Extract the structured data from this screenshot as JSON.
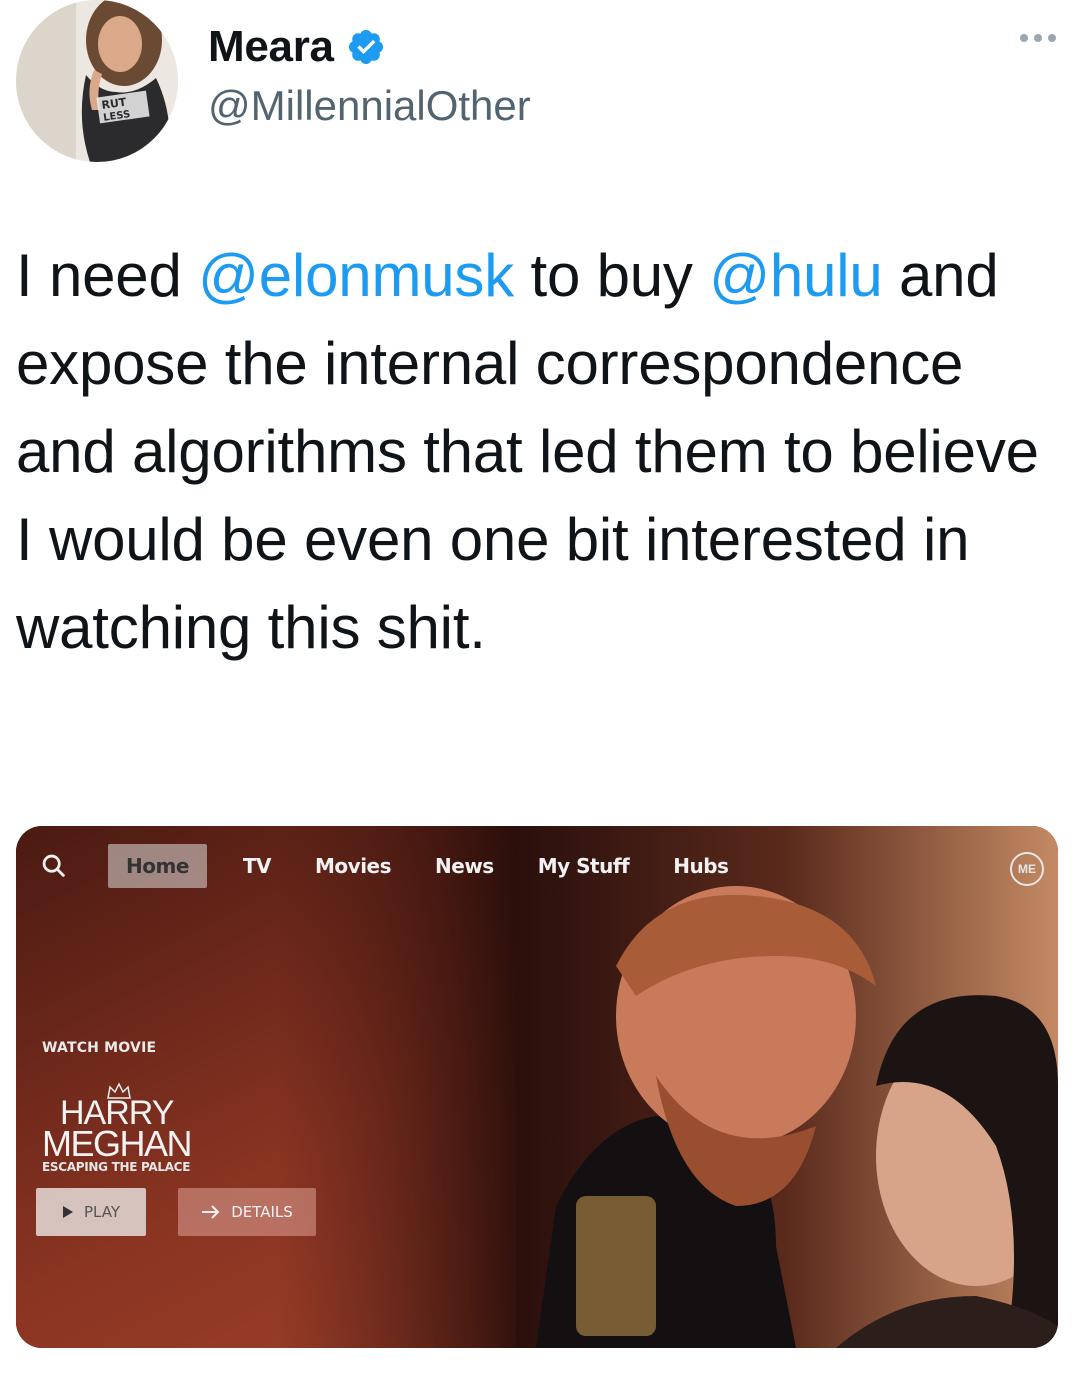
{
  "author": {
    "display_name": "Meara",
    "handle": "@MillennialOther",
    "verified_icon": "verified-badge-icon",
    "more_icon": "more-dots-icon"
  },
  "tweet": {
    "text_parts": {
      "p1": "I need ",
      "mention1": "@elonmusk",
      "p2": " to buy ",
      "mention2": "@hulu",
      "p3": " and expose the internal correspondence and algorithms that led them to believe I would be even one bit interested in watching this shit."
    },
    "mention_color": "#1d9bf0"
  },
  "media": {
    "nav": {
      "search_icon": "search-icon",
      "items": [
        "Home",
        "TV",
        "Movies",
        "News",
        "My Stuff",
        "Hubs"
      ],
      "active": "Home",
      "profile_label": "ME"
    },
    "promo": {
      "eyebrow": "WATCH MOVIE",
      "title_line1": "HARRY",
      "title_line2": "MEGHAN",
      "subtitle": "ESCAPING THE PALACE",
      "play_label": "PLAY",
      "details_label": "DETAILS"
    }
  }
}
